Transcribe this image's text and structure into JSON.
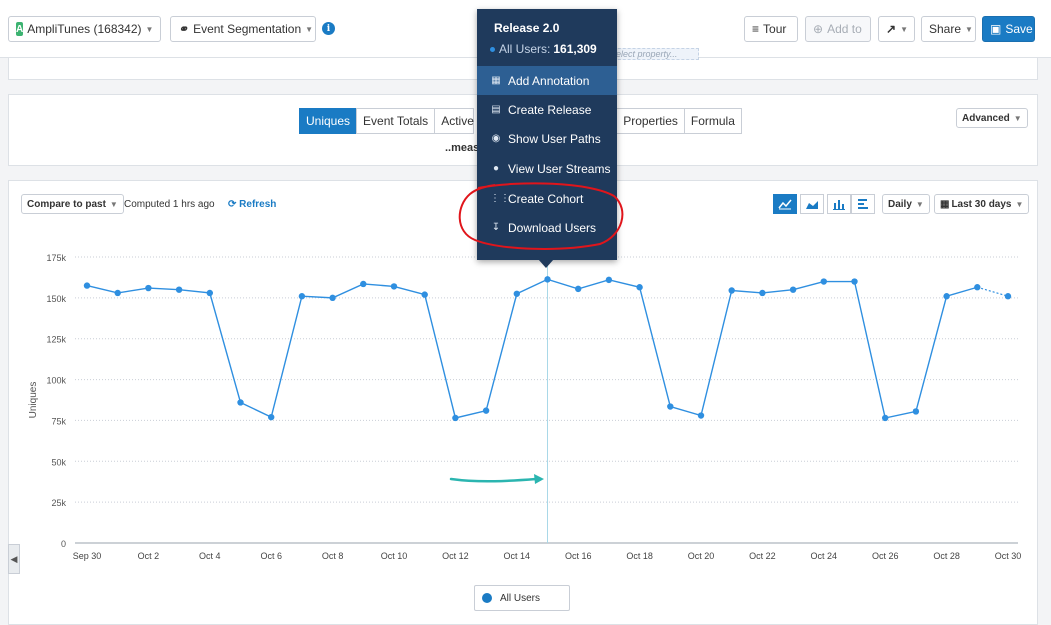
{
  "toolbar": {
    "app_badge": "A",
    "app_name": "AmpliTunes (168342)",
    "chart_type": "Event Segmentation",
    "info_icon": "i",
    "tour": "Tour",
    "add_to": "Add to",
    "share": "Share",
    "save": "Save"
  },
  "query": {
    "ghost_placeholder": "elect property..."
  },
  "measure_tabs": [
    "Uniques",
    "Event Totals",
    "Active",
    "Properties",
    "Formula"
  ],
  "measure_active": "Uniques",
  "measure_text": "..meas",
  "advanced": "Advanced",
  "chart_controls": {
    "compare": "Compare to past",
    "computed": "Computed 1 hrs ago",
    "refresh": "Refresh",
    "interval": "Daily",
    "range": "Last 30 days"
  },
  "icons": {
    "app": "app-badge",
    "segmentation": "segmentation-icon",
    "info": "info-icon",
    "tour": "tour-icon",
    "add": "plus-circle-icon",
    "export": "export-icon",
    "save": "save-icon",
    "refresh": "refresh-icon",
    "calendar": "calendar-icon"
  },
  "colors": {
    "accent": "#1a7bc4",
    "line": "#2f8fe0",
    "popup_bg": "#1f3a5c",
    "popup_active": "#2d5f93",
    "annotation_red": "#e0151b",
    "arrow_teal": "#2bb5b0"
  },
  "popup": {
    "title": "Release 2.0",
    "users_label": "All Users:",
    "users_value": "161,309",
    "items": [
      {
        "label": "Add Annotation",
        "icon": "calendar-icon"
      },
      {
        "label": "Create Release",
        "icon": "calendar-plus-icon"
      },
      {
        "label": "Show User Paths",
        "icon": "eye-icon"
      },
      {
        "label": "View User Streams",
        "icon": "user-icon"
      },
      {
        "label": "Create Cohort",
        "icon": "cohort-icon"
      },
      {
        "label": "Download Users",
        "icon": "download-icon"
      }
    ]
  },
  "legend": {
    "label": "All Users"
  },
  "chart_data": {
    "type": "line",
    "ylabel": "Uniques",
    "ylim": [
      0,
      175000
    ],
    "yticks": [
      0,
      25000,
      50000,
      75000,
      100000,
      125000,
      150000,
      175000
    ],
    "ytick_labels": [
      "0",
      "25k",
      "50k",
      "75k",
      "100k",
      "125k",
      "150k",
      "175k"
    ],
    "x": [
      "Sep 30",
      "Oct 1",
      "Oct 2",
      "Oct 3",
      "Oct 4",
      "Oct 5",
      "Oct 6",
      "Oct 7",
      "Oct 8",
      "Oct 9",
      "Oct 10",
      "Oct 11",
      "Oct 12",
      "Oct 13",
      "Oct 14",
      "Oct 15",
      "Oct 16",
      "Oct 17",
      "Oct 18",
      "Oct 19",
      "Oct 20",
      "Oct 21",
      "Oct 22",
      "Oct 23",
      "Oct 24",
      "Oct 25",
      "Oct 26",
      "Oct 27",
      "Oct 28",
      "Oct 29",
      "Oct 30"
    ],
    "xtick_labels": [
      "Sep 30",
      "Oct 2",
      "Oct 4",
      "Oct 6",
      "Oct 8",
      "Oct 10",
      "Oct 12",
      "Oct 14",
      "Oct 16",
      "Oct 18",
      "Oct 20",
      "Oct 22",
      "Oct 24",
      "Oct 26",
      "Oct 28",
      "Oct 30"
    ],
    "series": [
      {
        "name": "All Users",
        "values": [
          157500,
          153000,
          156000,
          155000,
          153000,
          86000,
          77000,
          151000,
          150000,
          158500,
          157000,
          152000,
          76500,
          81000,
          152500,
          161309,
          155500,
          161000,
          156500,
          83500,
          78000,
          154500,
          153000,
          155000,
          160000,
          160000,
          76500,
          80500,
          151000,
          156500,
          151000
        ]
      }
    ],
    "incomplete_last_point": true,
    "annotation_marker_x": "Oct 15",
    "grid": true
  }
}
